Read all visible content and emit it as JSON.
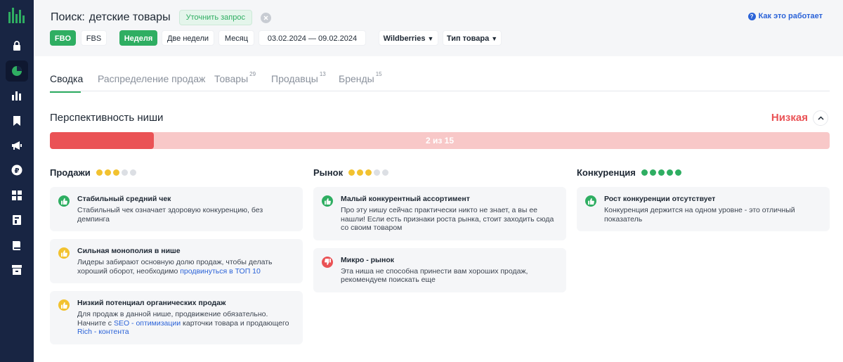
{
  "colors": {
    "sidebar_bg": "#182543",
    "accent_green": "#2fae62",
    "danger_red": "#ea5255",
    "warning_yellow": "#f2c230",
    "link_blue": "#2b63d8",
    "dot_empty": "#dcdfe4"
  },
  "sidebar": {
    "items": [
      {
        "icon": "lock-icon"
      },
      {
        "icon": "pie-chart-icon",
        "active": true
      },
      {
        "icon": "bar-chart-icon"
      },
      {
        "icon": "bookmark-icon"
      },
      {
        "icon": "megaphone-icon"
      },
      {
        "icon": "ruble-icon"
      },
      {
        "icon": "grid-icon"
      },
      {
        "icon": "document-icon"
      },
      {
        "icon": "book-icon"
      },
      {
        "icon": "archive-icon"
      }
    ]
  },
  "header": {
    "search_label": "Поиск:",
    "search_query": "детские товары",
    "refine_label": "Уточнить запрос",
    "help_link": "Как это работает"
  },
  "filters": {
    "fbo": "FBO",
    "fbs": "FBS",
    "week": "Неделя",
    "two_weeks": "Две недели",
    "month": "Месяц",
    "date_range": "03.02.2024 — 09.02.2024",
    "marketplace": "Wildberries",
    "product_type": "Тип товара"
  },
  "tabs": [
    {
      "label": "Сводка",
      "count": ""
    },
    {
      "label": "Распределение продаж",
      "count": ""
    },
    {
      "label": "Товары",
      "count": "29"
    },
    {
      "label": "Продавцы",
      "count": "13"
    },
    {
      "label": "Бренды",
      "count": "15"
    }
  ],
  "niche": {
    "title": "Перспективность ниши",
    "level": "Низкая",
    "score": 2,
    "max": 15,
    "score_label": "2 из 15"
  },
  "columns": [
    {
      "title": "Продажи",
      "rating": 3,
      "rating_max": 5,
      "rating_color": "#f2c230",
      "cards": [
        {
          "type": "positive",
          "title": "Стабильный средний чек",
          "text": "Стабильный чек означает здоровую конкуренцию, без демпинга",
          "link": "",
          "text_after": ""
        },
        {
          "type": "neutral",
          "title": "Сильная монополия в нише",
          "text": "Лидеры забирают основную долю продаж, чтобы делать хороший оборот, необходимо ",
          "link": "продвинуться в ТОП 10",
          "text_after": ""
        },
        {
          "type": "neutral",
          "title": "Низкий потенциал органических продаж",
          "text": "Для продаж в данной нише, продвижение обязательно. Начните с ",
          "link": "SEO - оптимизации",
          "text_after": " карточки товара и продающего ",
          "link2": "Rich - контента"
        }
      ]
    },
    {
      "title": "Рынок",
      "rating": 3,
      "rating_max": 5,
      "rating_color": "#f2c230",
      "cards": [
        {
          "type": "positive",
          "title": "Малый конкурентный ассортимент",
          "text": "Про эту нишу сейчас практически никто не знает, а вы ее нашли! Если есть признаки роста рынка, стоит заходить сюда со своим товаром",
          "link": "",
          "text_after": ""
        },
        {
          "type": "negative",
          "title": "Микро - рынок",
          "text": "Эта ниша не способна принести вам хороших продаж, рекомендуем поискать еще",
          "link": "",
          "text_after": ""
        }
      ]
    },
    {
      "title": "Конкуренция",
      "rating": 5,
      "rating_max": 5,
      "rating_color": "#2fae62",
      "cards": [
        {
          "type": "positive",
          "title": "Рост конкуренции отсутствует",
          "text": "Конкуренция держится на одном уровне - это отличный показатель",
          "link": "",
          "text_after": ""
        }
      ]
    }
  ]
}
